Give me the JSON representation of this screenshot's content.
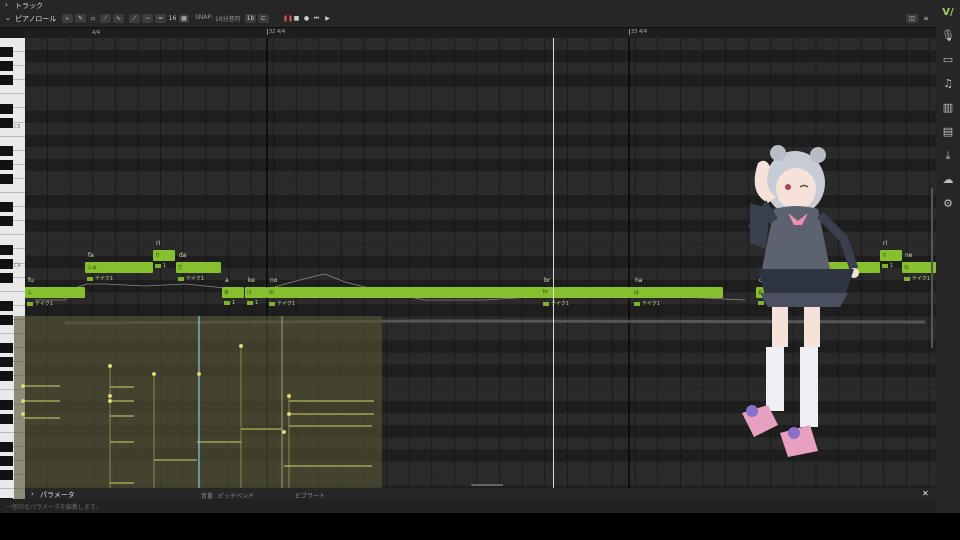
{
  "track_header": {
    "label": "トラック"
  },
  "piano_roll_header": {
    "label": "ピアノロール",
    "snap_label": "SNAP:",
    "snap_value": "16分音符",
    "quant_value": "16",
    "snap_toggle": "1b"
  },
  "ruler": {
    "markers": [
      "4/4",
      "32  4/4",
      "33  4/4"
    ]
  },
  "keyboard": {
    "octave_labels": [
      "C5",
      "C4"
    ]
  },
  "notes": [
    {
      "lyric": "fu",
      "text": "ふ",
      "take": "テイク1"
    },
    {
      "lyric": "fa",
      "text": "ふぁ",
      "take": "テイク1"
    },
    {
      "lyric": "ri",
      "text": "り",
      "take": "1"
    },
    {
      "lyric": "da",
      "text": "だ",
      "take": "テイク1"
    },
    {
      "lyric": "a",
      "text": "あ",
      "take": "1"
    },
    {
      "lyric": "ke",
      "text": "け",
      "take": "1"
    },
    {
      "lyric": "no",
      "text": "の",
      "take": "テイク1"
    },
    {
      "lyric": "br",
      "text": "br",
      "take": "テイク1"
    },
    {
      "lyric": "ha",
      "text": "は",
      "take": "テイク1"
    },
    {
      "lyric": "o",
      "text": "お",
      "take": "1"
    },
    {
      "lyric": "a",
      "text": "あ",
      "take": "テイク1"
    },
    {
      "lyric": "ri",
      "text": "り",
      "take": "1"
    },
    {
      "lyric": "ne",
      "text": "ね",
      "take": "テイク1"
    }
  ],
  "params_panel": {
    "label": "パラメータ",
    "tabs": [
      "音量",
      "ピッチベンド",
      "ビブラート"
    ],
    "hint": "一般的なパラメータを編集します。"
  },
  "colors": {
    "note": "#86c02e",
    "playhead": "#d8d8d8",
    "grid_dark": "#1e1e1e",
    "grid_light": "#2a2a2a"
  }
}
